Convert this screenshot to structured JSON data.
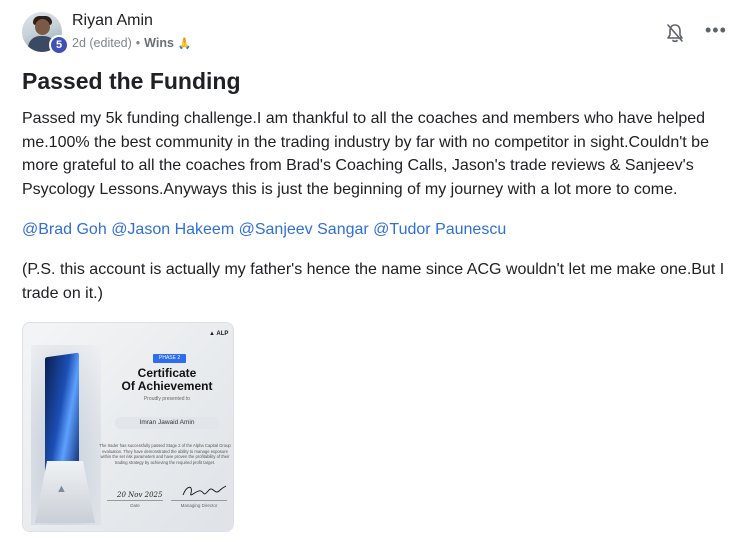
{
  "post": {
    "author": "Riyan Amin",
    "level": "5",
    "time": "2d (edited)",
    "separator": "•",
    "category": "Wins",
    "category_emoji": "🙏",
    "title": "Passed the Funding",
    "body_1": "Passed my 5k funding challenge.I am thankful to all the coaches and members who have helped me.100% the best community in the trading industry by far with no competitor in sight.Couldn't be more grateful to all the coaches from Brad's Coaching Calls, Jason's trade reviews & Sanjeev's Psycology Lessons.Anyways this is just the beginning of my journey with a lot more to come.",
    "mentions": [
      "@Brad Goh",
      "@Jason Hakeem",
      "@Sanjeev Sangar",
      "@Tudor Paunescu"
    ],
    "body_3": "(P.S. this account is actually my father's hence the name since ACG wouldn't let me make one.But I trade on it.)"
  },
  "actions": {
    "bell_icon": "bell-off-icon",
    "more_label": "•••"
  },
  "certificate": {
    "logo": "▲ ALP",
    "phase": "PHASE 2",
    "title_line1": "Certificate",
    "title_line2": "Of Achievement",
    "presented": "Proudly presented to",
    "name": "Imran Jawaid Amin",
    "body": "The trader has successfully passed Stage 2 of the Alpha Capital Group evaluation. They have demonstrated the ability to manage exposure within the set risk parameters and have proven the profitability of their trading strategy by achieving the required profit target.",
    "date": "20 Nov 2025",
    "date_label": "Date",
    "director_label": "Managing Director"
  },
  "colors": {
    "mention": "#2f6fd6",
    "badge": "#3f51b5"
  }
}
